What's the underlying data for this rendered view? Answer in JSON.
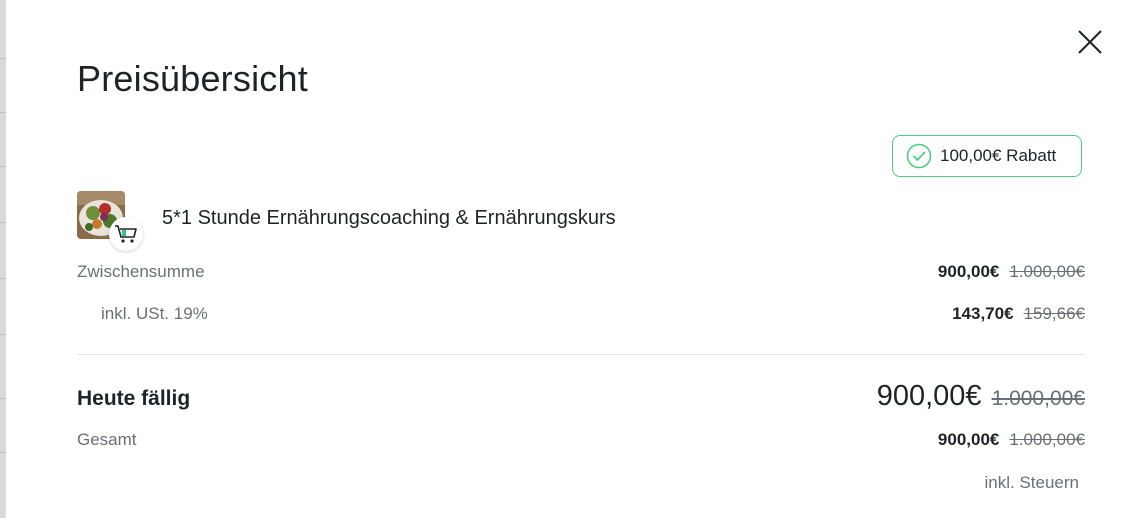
{
  "modal": {
    "title": "Preisübersicht",
    "close_icon": "close-icon"
  },
  "discount": {
    "label": "100,00€ Rabatt",
    "icon": "check-circle-icon",
    "color": "#4ccf7d"
  },
  "product": {
    "name": "5*1 Stunde Ernährungscoaching & Ernährungskurs",
    "thumbnail_icon": "food-bowl-image",
    "badge_icon": "shopping-cart-icon"
  },
  "lines": {
    "subtotal": {
      "label": "Zwischensumme",
      "price": "900,00€",
      "old_price": "1.000,00€"
    },
    "vat": {
      "label": "inkl. USt. 19%",
      "price": "143,70€",
      "old_price": "159,66€"
    }
  },
  "due_today": {
    "label": "Heute fällig",
    "price": "900,00€",
    "old_price": "1.000,00€"
  },
  "total": {
    "label": "Gesamt",
    "price": "900,00€",
    "old_price": "1.000,00€"
  },
  "tax_note": "inkl. Steuern"
}
